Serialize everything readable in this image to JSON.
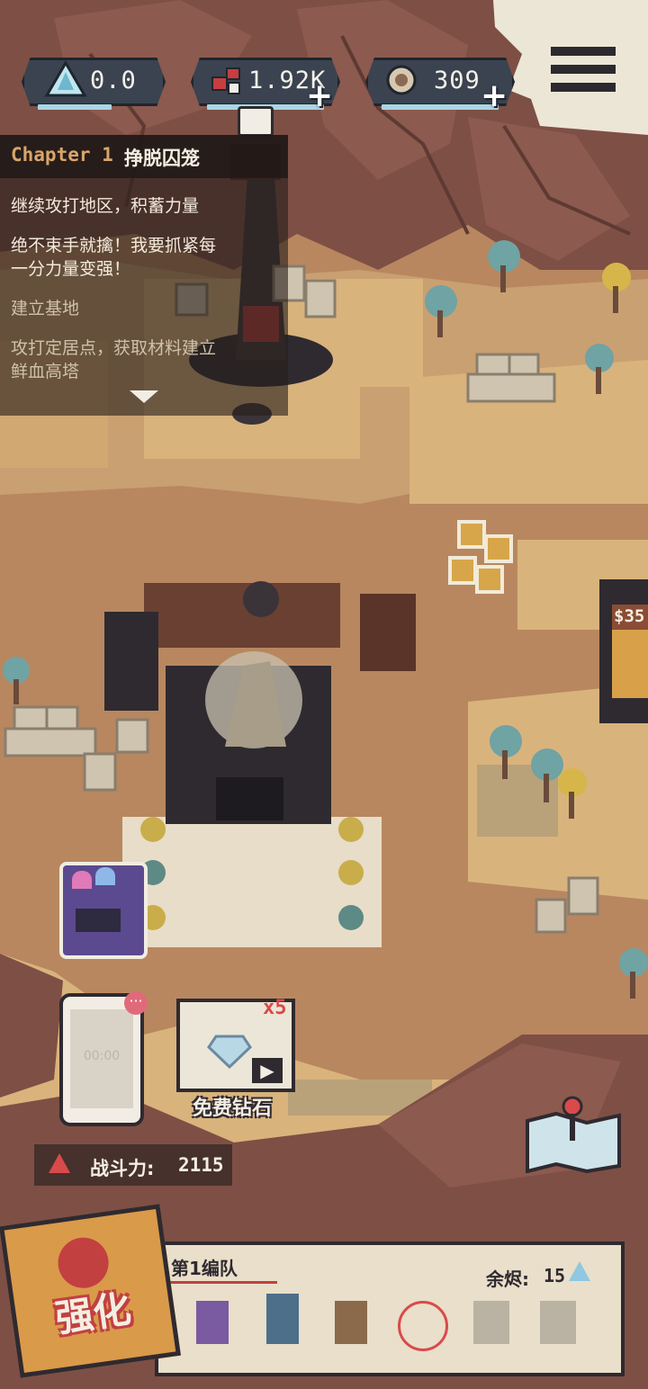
{
  "resources": [
    {
      "value": "0.0",
      "icon": "crystal-icon",
      "has_plus": false
    },
    {
      "value": "1.92K",
      "icon": "meat-icon",
      "has_plus": true
    },
    {
      "value": "309",
      "icon": "ore-icon",
      "has_plus": true
    }
  ],
  "quest": {
    "chapter_label": "Chapter 1",
    "chapter_title": "挣脱囚笼",
    "line1": "继续攻打地区，积蓄力量",
    "line2a": "绝不束手就擒！我要抓紧每",
    "line2b": "一分力量变强！",
    "line3": "建立基地",
    "line4a": "攻打定居点，获取材料建立",
    "line4b": "鲜血高塔"
  },
  "shop_sign": "$35",
  "free_diamond": {
    "label": "免费钻石",
    "badge": "x5"
  },
  "phone_text": "00:00",
  "combat": {
    "label": "战斗力:",
    "value": "2115"
  },
  "strengthen_label": "强化",
  "squad": {
    "title": "第1编队",
    "embers_label": "余烬:",
    "embers_value": "15"
  },
  "colors": {
    "ground": "#b8875f",
    "sand": "#dcb47a",
    "rock": "#7e4f45",
    "panel": "#3b4350",
    "accent": "#d94a4a"
  }
}
